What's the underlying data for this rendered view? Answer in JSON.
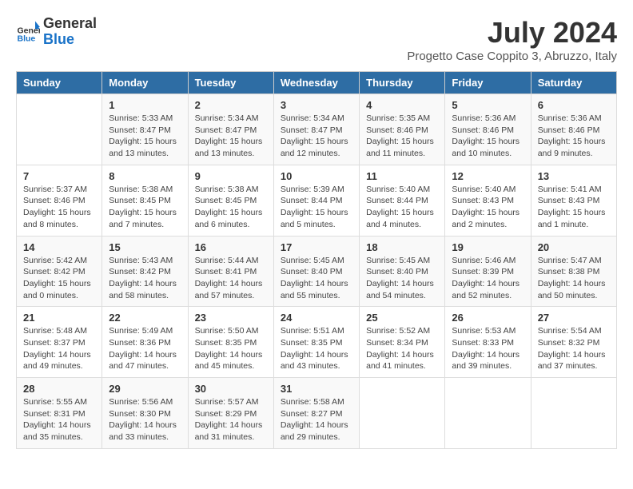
{
  "header": {
    "logo_line1": "General",
    "logo_line2": "Blue",
    "month_year": "July 2024",
    "location": "Progetto Case Coppito 3, Abruzzo, Italy"
  },
  "days_of_week": [
    "Sunday",
    "Monday",
    "Tuesday",
    "Wednesday",
    "Thursday",
    "Friday",
    "Saturday"
  ],
  "weeks": [
    [
      {
        "day": "",
        "info": ""
      },
      {
        "day": "1",
        "info": "Sunrise: 5:33 AM\nSunset: 8:47 PM\nDaylight: 15 hours\nand 13 minutes."
      },
      {
        "day": "2",
        "info": "Sunrise: 5:34 AM\nSunset: 8:47 PM\nDaylight: 15 hours\nand 13 minutes."
      },
      {
        "day": "3",
        "info": "Sunrise: 5:34 AM\nSunset: 8:47 PM\nDaylight: 15 hours\nand 12 minutes."
      },
      {
        "day": "4",
        "info": "Sunrise: 5:35 AM\nSunset: 8:46 PM\nDaylight: 15 hours\nand 11 minutes."
      },
      {
        "day": "5",
        "info": "Sunrise: 5:36 AM\nSunset: 8:46 PM\nDaylight: 15 hours\nand 10 minutes."
      },
      {
        "day": "6",
        "info": "Sunrise: 5:36 AM\nSunset: 8:46 PM\nDaylight: 15 hours\nand 9 minutes."
      }
    ],
    [
      {
        "day": "7",
        "info": "Sunrise: 5:37 AM\nSunset: 8:46 PM\nDaylight: 15 hours\nand 8 minutes."
      },
      {
        "day": "8",
        "info": "Sunrise: 5:38 AM\nSunset: 8:45 PM\nDaylight: 15 hours\nand 7 minutes."
      },
      {
        "day": "9",
        "info": "Sunrise: 5:38 AM\nSunset: 8:45 PM\nDaylight: 15 hours\nand 6 minutes."
      },
      {
        "day": "10",
        "info": "Sunrise: 5:39 AM\nSunset: 8:44 PM\nDaylight: 15 hours\nand 5 minutes."
      },
      {
        "day": "11",
        "info": "Sunrise: 5:40 AM\nSunset: 8:44 PM\nDaylight: 15 hours\nand 4 minutes."
      },
      {
        "day": "12",
        "info": "Sunrise: 5:40 AM\nSunset: 8:43 PM\nDaylight: 15 hours\nand 2 minutes."
      },
      {
        "day": "13",
        "info": "Sunrise: 5:41 AM\nSunset: 8:43 PM\nDaylight: 15 hours\nand 1 minute."
      }
    ],
    [
      {
        "day": "14",
        "info": "Sunrise: 5:42 AM\nSunset: 8:42 PM\nDaylight: 15 hours\nand 0 minutes."
      },
      {
        "day": "15",
        "info": "Sunrise: 5:43 AM\nSunset: 8:42 PM\nDaylight: 14 hours\nand 58 minutes."
      },
      {
        "day": "16",
        "info": "Sunrise: 5:44 AM\nSunset: 8:41 PM\nDaylight: 14 hours\nand 57 minutes."
      },
      {
        "day": "17",
        "info": "Sunrise: 5:45 AM\nSunset: 8:40 PM\nDaylight: 14 hours\nand 55 minutes."
      },
      {
        "day": "18",
        "info": "Sunrise: 5:45 AM\nSunset: 8:40 PM\nDaylight: 14 hours\nand 54 minutes."
      },
      {
        "day": "19",
        "info": "Sunrise: 5:46 AM\nSunset: 8:39 PM\nDaylight: 14 hours\nand 52 minutes."
      },
      {
        "day": "20",
        "info": "Sunrise: 5:47 AM\nSunset: 8:38 PM\nDaylight: 14 hours\nand 50 minutes."
      }
    ],
    [
      {
        "day": "21",
        "info": "Sunrise: 5:48 AM\nSunset: 8:37 PM\nDaylight: 14 hours\nand 49 minutes."
      },
      {
        "day": "22",
        "info": "Sunrise: 5:49 AM\nSunset: 8:36 PM\nDaylight: 14 hours\nand 47 minutes."
      },
      {
        "day": "23",
        "info": "Sunrise: 5:50 AM\nSunset: 8:35 PM\nDaylight: 14 hours\nand 45 minutes."
      },
      {
        "day": "24",
        "info": "Sunrise: 5:51 AM\nSunset: 8:35 PM\nDaylight: 14 hours\nand 43 minutes."
      },
      {
        "day": "25",
        "info": "Sunrise: 5:52 AM\nSunset: 8:34 PM\nDaylight: 14 hours\nand 41 minutes."
      },
      {
        "day": "26",
        "info": "Sunrise: 5:53 AM\nSunset: 8:33 PM\nDaylight: 14 hours\nand 39 minutes."
      },
      {
        "day": "27",
        "info": "Sunrise: 5:54 AM\nSunset: 8:32 PM\nDaylight: 14 hours\nand 37 minutes."
      }
    ],
    [
      {
        "day": "28",
        "info": "Sunrise: 5:55 AM\nSunset: 8:31 PM\nDaylight: 14 hours\nand 35 minutes."
      },
      {
        "day": "29",
        "info": "Sunrise: 5:56 AM\nSunset: 8:30 PM\nDaylight: 14 hours\nand 33 minutes."
      },
      {
        "day": "30",
        "info": "Sunrise: 5:57 AM\nSunset: 8:29 PM\nDaylight: 14 hours\nand 31 minutes."
      },
      {
        "day": "31",
        "info": "Sunrise: 5:58 AM\nSunset: 8:27 PM\nDaylight: 14 hours\nand 29 minutes."
      },
      {
        "day": "",
        "info": ""
      },
      {
        "day": "",
        "info": ""
      },
      {
        "day": "",
        "info": ""
      }
    ]
  ]
}
